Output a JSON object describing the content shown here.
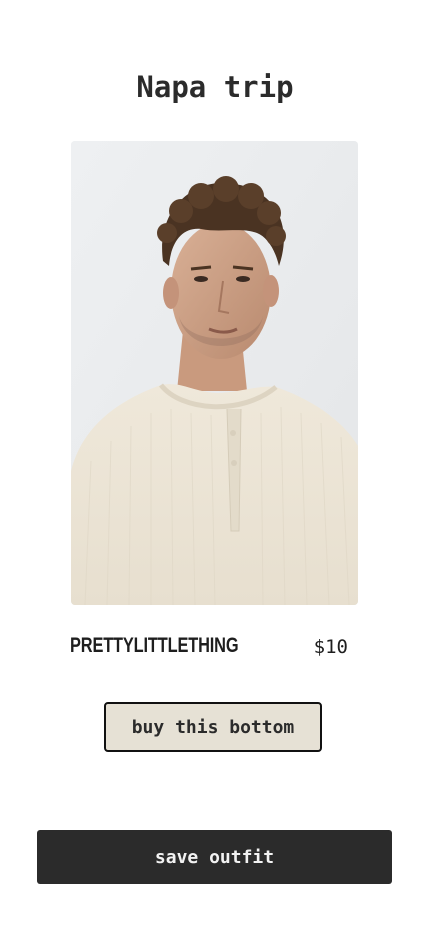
{
  "outfit": {
    "title": "Napa trip"
  },
  "product": {
    "brand": "PRETTYLITTLETHING",
    "price": "$10",
    "image_icon": "product-photo"
  },
  "actions": {
    "buy_label": "buy this bottom",
    "save_label": "save outfit"
  },
  "colors": {
    "buy_button_bg": "#e6e1d5",
    "save_button_bg": "#2b2b2b",
    "text": "#2b2b2b"
  }
}
